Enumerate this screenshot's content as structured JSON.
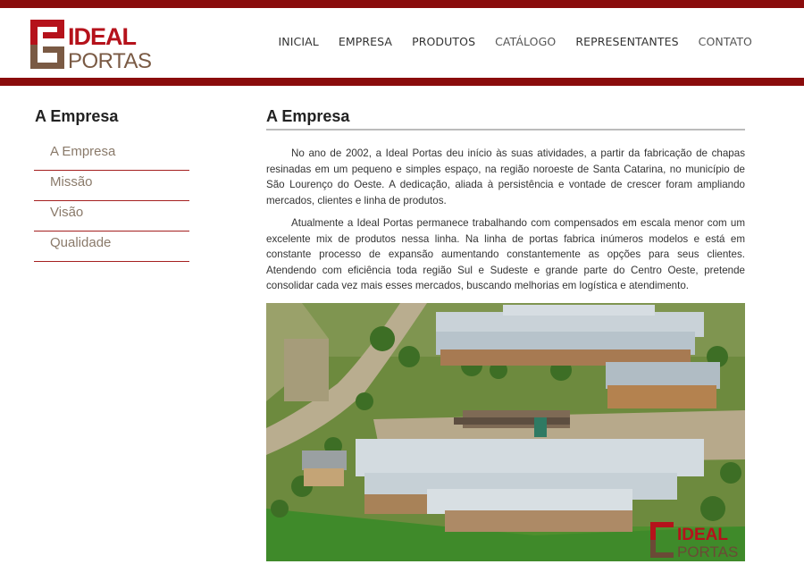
{
  "header": {
    "logo_line1": "IDEAL",
    "logo_line2": "PORTAS",
    "nav": [
      {
        "label": "INICIAL"
      },
      {
        "label": "EMPRESA"
      },
      {
        "label": "PRODUTOS"
      },
      {
        "label": "CATÁLOGO"
      },
      {
        "label": "REPRESENTANTES"
      },
      {
        "label": "CONTATO"
      }
    ]
  },
  "sidebar": {
    "title": "A Empresa",
    "items": [
      {
        "label": "A Empresa"
      },
      {
        "label": "Missão"
      },
      {
        "label": "Visão"
      },
      {
        "label": "Qualidade"
      }
    ]
  },
  "main": {
    "title": "A Empresa",
    "paragraphs": [
      "No ano de 2002, a Ideal Portas deu início às suas atividades, a partir da fabricação de chapas resinadas em um pequeno e simples espaço, na região noroeste de Santa Catarina, no município de São Lourenço do Oeste. A dedicação, aliada à persistência e vontade de crescer foram ampliando mercados, clientes e linha de produtos.",
      "Atualmente a Ideal Portas permanece trabalhando com compensados em escala menor com um excelente mix de produtos nessa linha. Na linha de portas fabrica inúmeros modelos e está em constante processo de expansão aumentando constantemente as opções para seus clientes. Atendendo com eficiência toda região Sul e Sudeste e grande parte do Centro Oeste, pretende consolidar cada vez mais esses mercados, buscando melhorias em logística e atendimento."
    ],
    "photo_watermark_line1": "IDEAL",
    "photo_watermark_line2": "PORTAS"
  },
  "colors": {
    "brand_red": "#8a0c0c",
    "logo_red": "#b5121b",
    "logo_brown": "#7a5a44",
    "sidebar_text": "#8a7a6a"
  }
}
